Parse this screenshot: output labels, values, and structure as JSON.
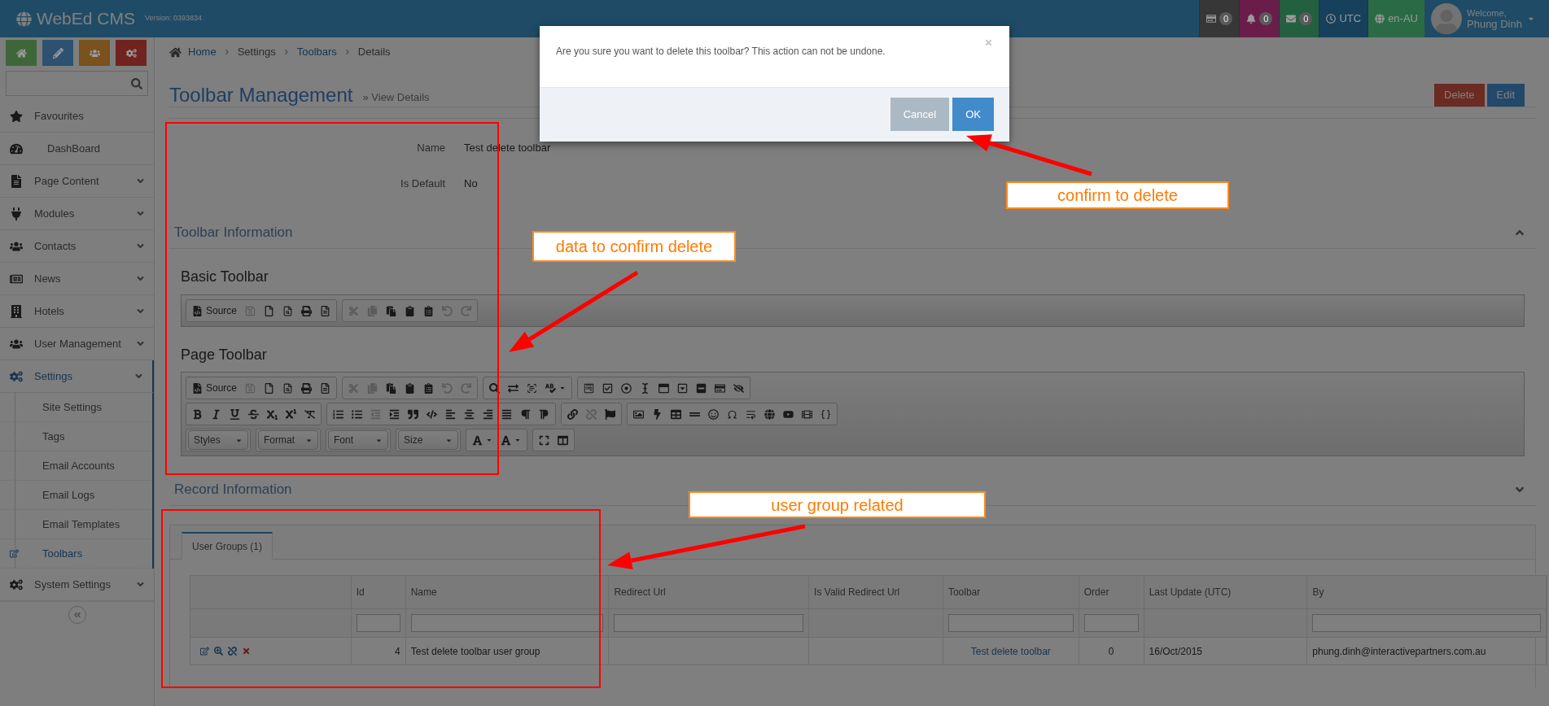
{
  "app": {
    "name": "WebEd CMS",
    "version": "Version: 0393834"
  },
  "top_indicators": [
    {
      "kind": "count",
      "text": "0",
      "color": "#373737"
    },
    {
      "kind": "count",
      "text": "0",
      "color": "#6b1d4a"
    },
    {
      "kind": "count",
      "text": "0",
      "color": "#236040"
    },
    {
      "kind": "label",
      "text": "UTC",
      "color": "#17405c"
    },
    {
      "kind": "label",
      "text": "en-AU",
      "color": "#2a6b45"
    }
  ],
  "user": {
    "greeting": "Welcome,",
    "name": "Phung Dinh"
  },
  "shortcuts": [
    {
      "color": "#3e6739"
    },
    {
      "color": "#2d5170"
    },
    {
      "color": "#79521d"
    },
    {
      "color": "#70231f"
    }
  ],
  "sidebar": {
    "items": [
      {
        "label": "Favourites",
        "selected": false,
        "kind": "link"
      },
      {
        "label": "DashBoard",
        "selected": false,
        "kind": "link"
      },
      {
        "label": "Page Content",
        "selected": false,
        "kind": "menu"
      },
      {
        "label": "Modules",
        "selected": false,
        "kind": "menu"
      },
      {
        "label": "Contacts",
        "selected": false,
        "kind": "menu"
      },
      {
        "label": "News",
        "selected": false,
        "kind": "menu"
      },
      {
        "label": "Hotels",
        "selected": false,
        "kind": "menu"
      },
      {
        "label": "User Management",
        "selected": false,
        "kind": "menu"
      },
      {
        "label": "Settings",
        "selected": true,
        "kind": "menu",
        "expanded": true,
        "children": [
          {
            "label": "Site Settings",
            "selected": false
          },
          {
            "label": "Tags",
            "selected": false
          },
          {
            "label": "Email Accounts",
            "selected": false
          },
          {
            "label": "Email Logs",
            "selected": false
          },
          {
            "label": "Email Templates",
            "selected": false
          },
          {
            "label": "Toolbars",
            "selected": true
          }
        ]
      },
      {
        "label": "System Settings",
        "selected": false,
        "kind": "menu"
      }
    ]
  },
  "breadcrumb": [
    {
      "label": "Home",
      "kind": "link"
    },
    {
      "label": "Settings",
      "kind": "text"
    },
    {
      "label": "Toolbars",
      "kind": "link"
    },
    {
      "label": "Details",
      "kind": "text"
    }
  ],
  "page": {
    "title": "Toolbar Management",
    "subtitle": "» View Details"
  },
  "actions": [
    {
      "label": "Delete",
      "kind": "danger"
    },
    {
      "label": "Edit",
      "kind": "primary"
    }
  ],
  "details": [
    {
      "label": "Name",
      "value": "Test delete toolbar"
    },
    {
      "label": "Is Default",
      "value": "No"
    }
  ],
  "sections": [
    {
      "title": "Toolbar Information",
      "expanded": true
    },
    {
      "title": "Record Information",
      "expanded": false
    }
  ],
  "toolbars": [
    {
      "title": "Basic Toolbar",
      "rows": [
        [
          [
            {
              "kind": "source",
              "label": "Source",
              "disabled": false
            },
            {
              "kind": "save",
              "disabled": true
            },
            {
              "kind": "newpage",
              "disabled": false
            },
            {
              "kind": "preview",
              "disabled": false
            },
            {
              "kind": "print",
              "disabled": false
            },
            {
              "kind": "templates",
              "disabled": false
            }
          ],
          [
            {
              "kind": "cut",
              "disabled": true
            },
            {
              "kind": "copy",
              "disabled": true
            },
            {
              "kind": "paste",
              "disabled": false
            },
            {
              "kind": "pastetext",
              "disabled": false
            },
            {
              "kind": "pasteword",
              "disabled": false
            },
            {
              "kind": "undo",
              "disabled": true
            },
            {
              "kind": "redo",
              "disabled": true
            }
          ]
        ]
      ]
    },
    {
      "title": "Page Toolbar",
      "rows": [
        [
          [
            {
              "kind": "source",
              "label": "Source",
              "disabled": false
            },
            {
              "kind": "save",
              "disabled": true
            },
            {
              "kind": "newpage",
              "disabled": false
            },
            {
              "kind": "preview",
              "disabled": false
            },
            {
              "kind": "print",
              "disabled": false
            },
            {
              "kind": "templates",
              "disabled": false
            }
          ],
          [
            {
              "kind": "cut",
              "disabled": true
            },
            {
              "kind": "copy",
              "disabled": true
            },
            {
              "kind": "paste",
              "disabled": false
            },
            {
              "kind": "pastetext",
              "disabled": false
            },
            {
              "kind": "pasteword",
              "disabled": false
            },
            {
              "kind": "undo",
              "disabled": true
            },
            {
              "kind": "redo",
              "disabled": true
            }
          ],
          [
            {
              "kind": "find",
              "disabled": false
            },
            {
              "kind": "replace",
              "disabled": false
            },
            {
              "kind": "selectall",
              "disabled": false
            },
            {
              "kind": "spellcheck",
              "disabled": false
            }
          ],
          [
            {
              "kind": "form",
              "disabled": false
            },
            {
              "kind": "checkbox",
              "disabled": false
            },
            {
              "kind": "radio",
              "disabled": false
            },
            {
              "kind": "textfield",
              "disabled": false
            },
            {
              "kind": "textarea",
              "disabled": false
            },
            {
              "kind": "select",
              "disabled": false
            },
            {
              "kind": "formbutton",
              "disabled": false
            },
            {
              "kind": "imagebutton",
              "disabled": false
            },
            {
              "kind": "hiddenfield",
              "disabled": false
            }
          ]
        ],
        [
          [
            {
              "kind": "bold",
              "disabled": false
            },
            {
              "kind": "italic",
              "disabled": false
            },
            {
              "kind": "underline",
              "disabled": false
            },
            {
              "kind": "strike",
              "disabled": false
            },
            {
              "kind": "subscript",
              "disabled": false
            },
            {
              "kind": "superscript",
              "disabled": false
            },
            {
              "kind": "removeformat",
              "disabled": false
            }
          ],
          [
            {
              "kind": "numlist",
              "disabled": false
            },
            {
              "kind": "bulletlist",
              "disabled": false
            },
            {
              "kind": "outdent",
              "disabled": true
            },
            {
              "kind": "indent",
              "disabled": false
            },
            {
              "kind": "blockquote",
              "disabled": false
            },
            {
              "kind": "div",
              "disabled": false
            },
            {
              "kind": "alignleft",
              "disabled": false
            },
            {
              "kind": "aligncenter",
              "disabled": false
            },
            {
              "kind": "alignright",
              "disabled": false
            },
            {
              "kind": "justify",
              "disabled": false
            },
            {
              "kind": "ltr",
              "disabled": false
            },
            {
              "kind": "rtl",
              "disabled": false
            }
          ],
          [
            {
              "kind": "link",
              "disabled": false
            },
            {
              "kind": "unlink",
              "disabled": true
            },
            {
              "kind": "anchor",
              "disabled": false
            }
          ],
          [
            {
              "kind": "image",
              "disabled": false
            },
            {
              "kind": "flash",
              "disabled": false
            },
            {
              "kind": "table",
              "disabled": false
            },
            {
              "kind": "hr",
              "disabled": false
            },
            {
              "kind": "smiley",
              "disabled": false
            },
            {
              "kind": "specialchar",
              "disabled": false
            },
            {
              "kind": "pagebreak",
              "disabled": false
            },
            {
              "kind": "iframe",
              "disabled": false
            },
            {
              "kind": "youtube",
              "disabled": false
            },
            {
              "kind": "video",
              "disabled": false
            },
            {
              "kind": "placeholder",
              "disabled": false
            }
          ]
        ],
        [
          [
            {
              "kind": "combo",
              "label": "Styles",
              "disabled": false
            }
          ],
          [
            {
              "kind": "combo",
              "label": "Format",
              "disabled": false
            }
          ],
          [
            {
              "kind": "combo",
              "label": "Font",
              "disabled": false
            }
          ],
          [
            {
              "kind": "combo",
              "label": "Size",
              "disabled": false
            }
          ],
          [
            {
              "kind": "textcolor",
              "disabled": false
            },
            {
              "kind": "bgcolor",
              "disabled": false
            }
          ],
          [
            {
              "kind": "maximize",
              "disabled": false
            },
            {
              "kind": "showblocks",
              "disabled": false
            }
          ]
        ]
      ]
    }
  ],
  "tabs": [
    {
      "label": "User Groups (1)",
      "selected": true
    }
  ],
  "table": {
    "columns": [
      {
        "label": "Id",
        "filter": true
      },
      {
        "label": "Name",
        "filter": true
      },
      {
        "label": "Redirect Url",
        "filter": true
      },
      {
        "label": "Is Valid Redirect Url",
        "filter": false
      },
      {
        "label": "Toolbar",
        "filter": true
      },
      {
        "label": "Order",
        "filter": true
      },
      {
        "label": "Last Update (UTC)",
        "filter": false
      },
      {
        "label": "By",
        "filter": true
      }
    ],
    "rows": [
      {
        "cells": [
          "4",
          "Test delete toolbar user group",
          "",
          "",
          "Test delete toolbar",
          "0",
          "16/Oct/2015",
          "phung.dinh@interactivepartners.com.au"
        ]
      }
    ]
  },
  "modal": {
    "message": "Are you sure you want to delete this toolbar? This action can not be undone.",
    "buttons": [
      {
        "label": "Cancel",
        "kind": "secondary"
      },
      {
        "label": "OK",
        "kind": "primary"
      }
    ]
  },
  "annotations": [
    {
      "text": "confirm to delete"
    },
    {
      "text": "data to confirm delete"
    },
    {
      "text": "user group related"
    }
  ]
}
